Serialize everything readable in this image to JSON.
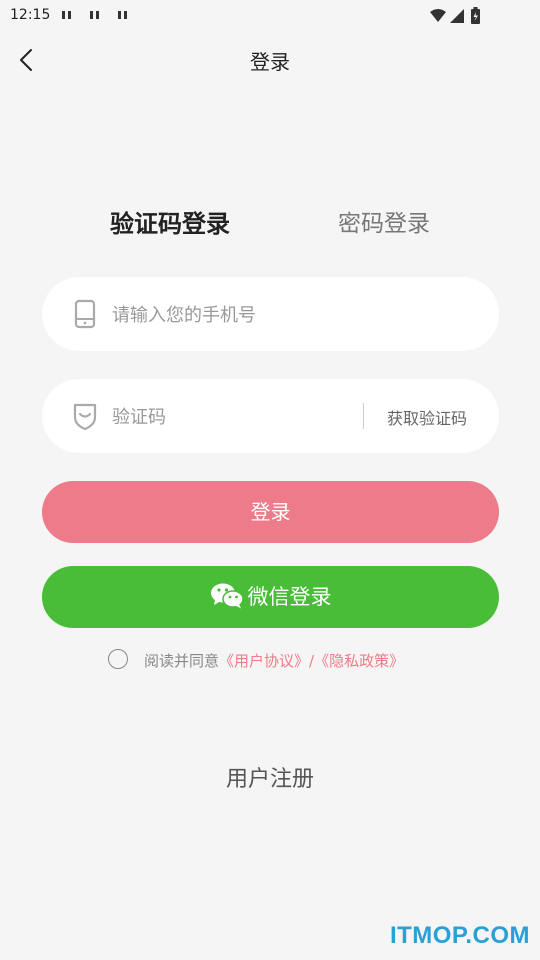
{
  "status_bar": {
    "time": "12:15"
  },
  "header": {
    "title": "登录"
  },
  "tabs": {
    "sms": "验证码登录",
    "password": "密码登录"
  },
  "phone": {
    "placeholder": "请输入您的手机号"
  },
  "code": {
    "placeholder": "验证码",
    "get_code": "获取验证码"
  },
  "buttons": {
    "login": "登录",
    "wechat": "微信登录"
  },
  "agreement": {
    "prefix": "阅读并同意",
    "user_agreement": "《用户协议》",
    "separator": "/",
    "privacy_policy": "《隐私政策》"
  },
  "register": "用户注册",
  "watermark": "ITMOP.COM",
  "colors": {
    "login_button": "#ee7b89",
    "wechat_button": "#49bd38",
    "link": "#ee7b89",
    "background": "#f5f5f5"
  },
  "icons": {
    "back": "chevron-left-icon",
    "phone": "phone-icon",
    "code": "shield-icon",
    "wechat": "wechat-icon"
  }
}
